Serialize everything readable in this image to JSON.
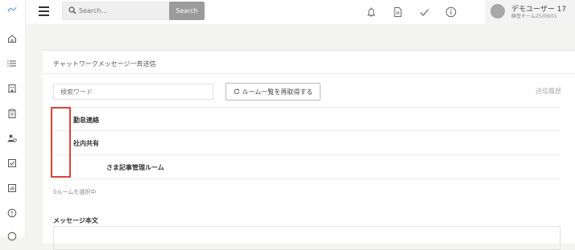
{
  "sidebar": {
    "logo": "logo-icon",
    "items": [
      {
        "name": "home",
        "icon": "home-icon"
      },
      {
        "name": "list",
        "icon": "list-icon"
      },
      {
        "name": "building",
        "icon": "building-icon"
      },
      {
        "name": "clipboard",
        "icon": "clipboard-icon"
      },
      {
        "name": "user-settings",
        "icon": "user-settings-icon"
      },
      {
        "name": "checkbox",
        "icon": "checkbox-icon"
      },
      {
        "name": "report",
        "icon": "report-icon"
      },
      {
        "name": "info",
        "icon": "info-icon"
      }
    ]
  },
  "header": {
    "search_placeholder": "Search...",
    "search_button": "Search",
    "user_name": "デモユーザー 17",
    "user_team": "練習チーム25/09/01",
    "icons": [
      "bell-icon",
      "document-icon",
      "check-icon",
      "info-icon"
    ]
  },
  "main": {
    "title": "チャットワークメッセージ一斉送信",
    "keyword_placeholder": "検索ワード",
    "reload_button": "ルーム一覧を再取得する",
    "history_link": "送信履歴",
    "rooms": [
      {
        "name": "勤怠連絡",
        "indent": 1
      },
      {
        "name": "社内共有",
        "indent": 1
      },
      {
        "name": "さま記事管理ルーム",
        "indent": 2
      }
    ],
    "selected_count": "0ルームを選択中",
    "message_label": "メッセージ本文"
  },
  "colors": {
    "highlight_border": "#d9453a",
    "search_button_bg": "#9b9b9b",
    "page_bg": "#f4f4f2"
  }
}
